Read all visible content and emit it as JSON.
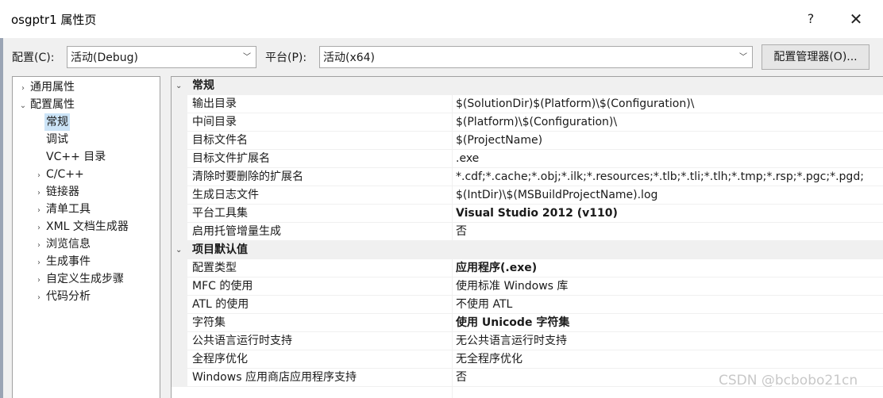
{
  "window": {
    "title": "osgptr1 属性页",
    "help_label": "?",
    "close_label": "✕"
  },
  "toolbar": {
    "config_label": "配置(C):",
    "config_value": "活动(Debug)",
    "platform_label": "平台(P):",
    "platform_value": "活动(x64)",
    "manager_button": "配置管理器(O)...",
    "chevron": "﹀"
  },
  "tree": {
    "items": [
      {
        "label": "通用属性",
        "arrow": "›"
      },
      {
        "label": "配置属性",
        "arrow": "⌄"
      },
      {
        "label": "常规",
        "arrow": ""
      },
      {
        "label": "调试",
        "arrow": ""
      },
      {
        "label": "VC++ 目录",
        "arrow": ""
      },
      {
        "label": "C/C++",
        "arrow": "›"
      },
      {
        "label": "链接器",
        "arrow": "›"
      },
      {
        "label": "清单工具",
        "arrow": "›"
      },
      {
        "label": "XML 文档生成器",
        "arrow": "›"
      },
      {
        "label": "浏览信息",
        "arrow": "›"
      },
      {
        "label": "生成事件",
        "arrow": "›"
      },
      {
        "label": "自定义生成步骤",
        "arrow": "›"
      },
      {
        "label": "代码分析",
        "arrow": "›"
      }
    ]
  },
  "grid": {
    "sections": [
      {
        "title": "常规",
        "arrow": "⌄",
        "rows": [
          {
            "name": "输出目录",
            "value": "$(SolutionDir)$(Platform)\\$(Configuration)\\"
          },
          {
            "name": "中间目录",
            "value": "$(Platform)\\$(Configuration)\\"
          },
          {
            "name": "目标文件名",
            "value": "$(ProjectName)"
          },
          {
            "name": "目标文件扩展名",
            "value": ".exe"
          },
          {
            "name": "清除时要删除的扩展名",
            "value": "*.cdf;*.cache;*.obj;*.ilk;*.resources;*.tlb;*.tli;*.tlh;*.tmp;*.rsp;*.pgc;*.pgd;"
          },
          {
            "name": "生成日志文件",
            "value": "$(IntDir)\\$(MSBuildProjectName).log"
          },
          {
            "name": "平台工具集",
            "value": "Visual Studio 2012 (v110)"
          },
          {
            "name": "启用托管增量生成",
            "value": "否"
          }
        ]
      },
      {
        "title": "项目默认值",
        "arrow": "⌄",
        "rows": [
          {
            "name": "配置类型",
            "value": "应用程序(.exe)"
          },
          {
            "name": "MFC 的使用",
            "value": "使用标准 Windows 库"
          },
          {
            "name": "ATL 的使用",
            "value": "不使用 ATL"
          },
          {
            "name": "字符集",
            "value": "使用 Unicode 字符集"
          },
          {
            "name": "公共语言运行时支持",
            "value": "无公共语言运行时支持"
          },
          {
            "name": "全程序优化",
            "value": "无全程序优化"
          },
          {
            "name": "Windows 应用商店应用程序支持",
            "value": "否"
          }
        ]
      }
    ]
  },
  "watermark": "CSDN @bcbobo21cn"
}
